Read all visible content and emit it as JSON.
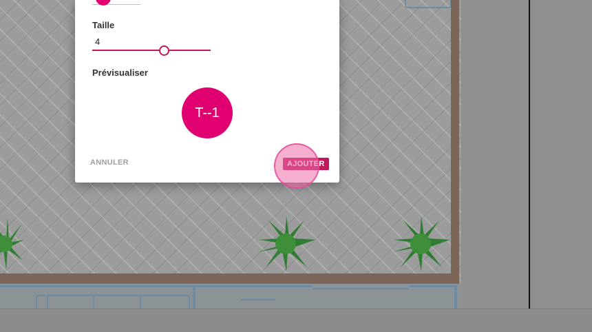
{
  "dialog": {
    "size_label": "Taille",
    "size_value": "4",
    "size_slider_fraction": 0.61,
    "preview_label": "Prévisualiser",
    "preview_text": "T--1",
    "cancel_label": "ANNULER",
    "add_label": "AJOUTER"
  },
  "colors": {
    "accent": "#c2185b",
    "preview_fill": "#e0006f",
    "wall": "#7a6558",
    "overlay": "#8f8f8f"
  }
}
